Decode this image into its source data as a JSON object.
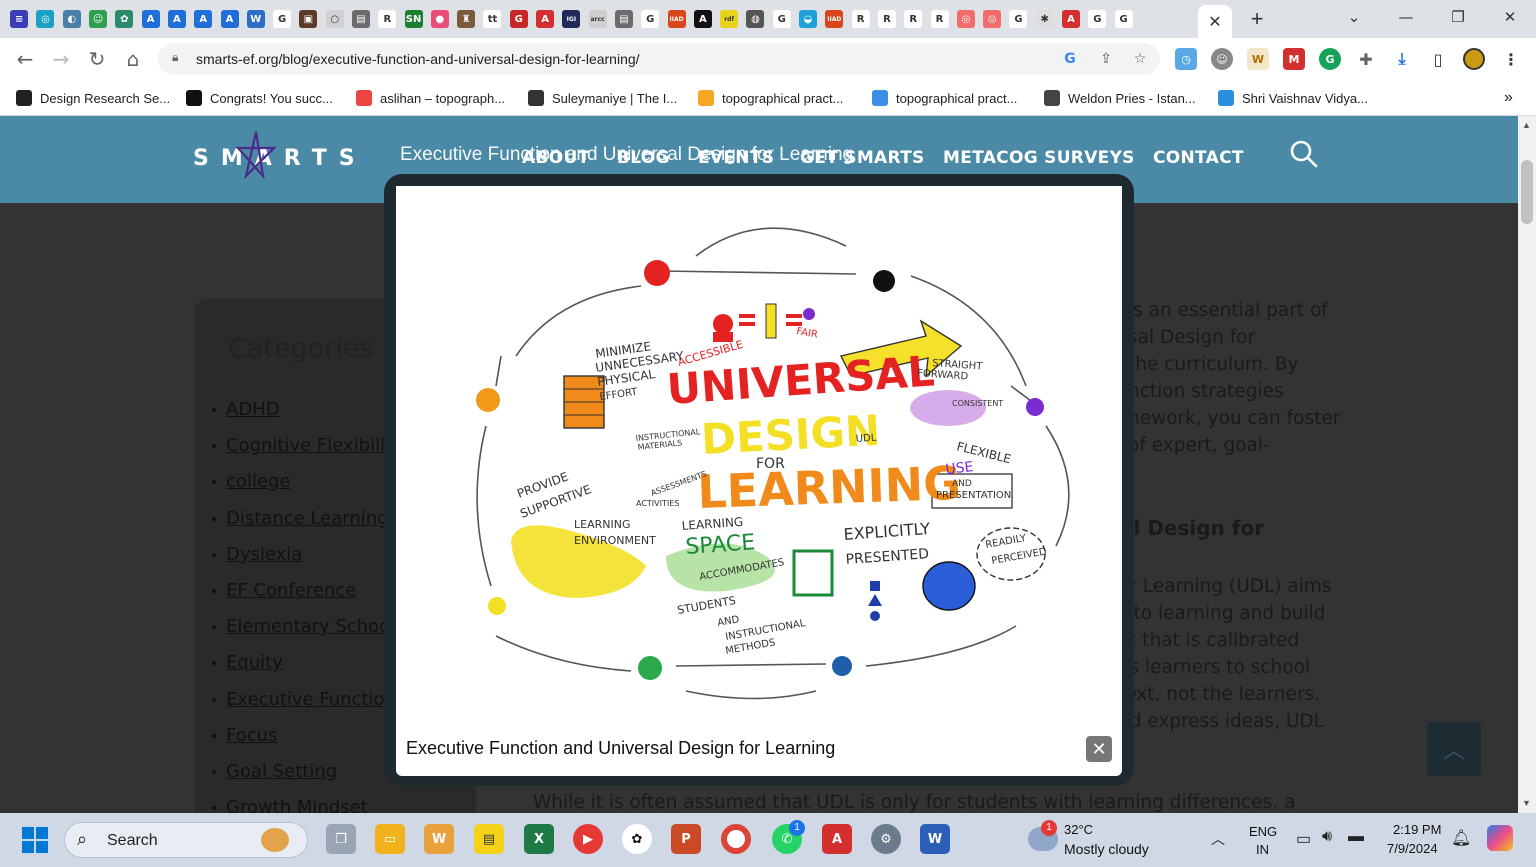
{
  "browser": {
    "tab_favicons": [
      {
        "icon": "list-icon",
        "color": "#3b3fb6",
        "glyph": "≡"
      },
      {
        "icon": "photo-icon",
        "color": "#19a0c2",
        "glyph": "◎"
      },
      {
        "icon": "globe-icon",
        "color": "#4a7fa8",
        "glyph": "◐"
      },
      {
        "icon": "android-icon",
        "color": "#2f9e4f",
        "glyph": "☺"
      },
      {
        "icon": "openai-icon",
        "color": "#2a8a6a",
        "glyph": "✿"
      },
      {
        "icon": "letter-a-icon",
        "color": "#1e6fd9",
        "glyph": "A"
      },
      {
        "icon": "letter-a-icon",
        "color": "#1e6fd9",
        "glyph": "A"
      },
      {
        "icon": "letter-a-icon",
        "color": "#1e6fd9",
        "glyph": "A"
      },
      {
        "icon": "letter-a-icon",
        "color": "#1e6fd9",
        "glyph": "A"
      },
      {
        "icon": "wordpress-icon",
        "color": "#2b6fc4",
        "glyph": "W"
      },
      {
        "icon": "google-icon",
        "color": "#ffffff",
        "glyph": "G"
      },
      {
        "icon": "image-icon",
        "color": "#5b3a2a",
        "glyph": "▣"
      },
      {
        "icon": "ring-icon",
        "color": "#d0d0d0",
        "glyph": "○"
      },
      {
        "icon": "picture-icon",
        "color": "#6b6b6b",
        "glyph": "▤"
      },
      {
        "icon": "researchgate-icon",
        "color": "#ffffff",
        "glyph": "R"
      },
      {
        "icon": "sn-icon",
        "color": "#1a7f2e",
        "glyph": "SN"
      },
      {
        "icon": "chat-icon",
        "color": "#e94c77",
        "glyph": "●"
      },
      {
        "icon": "castle-icon",
        "color": "#7a5a3a",
        "glyph": "♜"
      },
      {
        "icon": "tt-icon",
        "color": "#ffffff",
        "glyph": "tt"
      },
      {
        "icon": "grammarly-icon",
        "color": "#c62828",
        "glyph": "G"
      },
      {
        "icon": "pdf-icon",
        "color": "#d32f2f",
        "glyph": "A"
      },
      {
        "icon": "igi-icon",
        "color": "#1f2a5a",
        "glyph": "IGI"
      },
      {
        "icon": "arcc-icon",
        "color": "#cfcfcf",
        "glyph": "arcc"
      },
      {
        "icon": "picture-icon",
        "color": "#6b6b6b",
        "glyph": "▤"
      },
      {
        "icon": "google-icon",
        "color": "#ffffff",
        "glyph": "G"
      },
      {
        "icon": "iiad-icon",
        "color": "#d9461b",
        "glyph": "IIAD"
      },
      {
        "icon": "letter-a-box-icon",
        "color": "#111111",
        "glyph": "A"
      },
      {
        "icon": "rdf-icon",
        "color": "#e8d21a",
        "glyph": "rdf"
      },
      {
        "icon": "globe-icon",
        "color": "#555555",
        "glyph": "◍"
      },
      {
        "icon": "google-icon",
        "color": "#ffffff",
        "glyph": "G"
      },
      {
        "icon": "circle-icon",
        "color": "#1ca0d6",
        "glyph": "◒"
      },
      {
        "icon": "iiad-icon",
        "color": "#d9461b",
        "glyph": "IIAD"
      },
      {
        "icon": "researchgate-icon",
        "color": "#ffffff",
        "glyph": "R"
      },
      {
        "icon": "researchgate-icon",
        "color": "#ffffff",
        "glyph": "R"
      },
      {
        "icon": "researchgate-icon",
        "color": "#ffffff",
        "glyph": "R"
      },
      {
        "icon": "researchgate-icon",
        "color": "#ffffff",
        "glyph": "R"
      },
      {
        "icon": "target-icon",
        "color": "#f36b6b",
        "glyph": "◎"
      },
      {
        "icon": "target-icon",
        "color": "#f36b6b",
        "glyph": "◎"
      },
      {
        "icon": "google-icon",
        "color": "#ffffff",
        "glyph": "G"
      },
      {
        "icon": "settings-icon",
        "color": "#dddddd",
        "glyph": "✱"
      },
      {
        "icon": "pdf-icon",
        "color": "#d32f2f",
        "glyph": "A"
      },
      {
        "icon": "google-icon",
        "color": "#ffffff",
        "glyph": "G"
      },
      {
        "icon": "google-icon",
        "color": "#ffffff",
        "glyph": "G"
      }
    ],
    "active_tab_close": "✕",
    "new_tab": "+",
    "url": "smarts-ef.org/blog/executive-function-and-universal-design-for-learning/",
    "bookmarks": [
      {
        "label": "Design Research Se...",
        "icon": "design-research-icon",
        "color": "#222"
      },
      {
        "label": "Congrats! You succ...",
        "icon": "media-icon",
        "color": "#111"
      },
      {
        "label": "aslihan – topograph...",
        "icon": "medium-icon",
        "color": "#e44"
      },
      {
        "label": "Suleymaniye | The I...",
        "icon": "mosque-icon",
        "color": "#333"
      },
      {
        "label": "topographical pract...",
        "icon": "jd-icon",
        "color": "#f5a623"
      },
      {
        "label": "topographical pract...",
        "icon": "folder-icon",
        "color": "#3a8ee6"
      },
      {
        "label": "Weldon Pries - Istan...",
        "icon": "globe-icon",
        "color": "#444"
      },
      {
        "label": "Shri Vaishnav Vidya...",
        "icon": "cloud-icon",
        "color": "#2b8fe0"
      }
    ],
    "bookmarks_more": "»"
  },
  "site": {
    "logo": "SMARTS",
    "overlay_title": "Executive Function and Universal Design for Learning",
    "nav": [
      "ABOUT",
      "BLOG",
      "EVENTS",
      "GET SMARTS",
      "METACOG SURVEYS",
      "CONTACT"
    ],
    "categories_title": "Categories",
    "categories": [
      "ADHD",
      "Cognitive Flexibility",
      "college",
      "Distance Learning",
      "Dyslexia",
      "EF Conference",
      "Elementary School",
      "Equity",
      "Executive Function",
      "Focus",
      "Goal Setting",
      "Growth Mindset"
    ],
    "article_lines": [
      "is an essential part of",
      "sal Design for",
      "the curriculum. By",
      "nction strategies",
      "nework, you can foster",
      "of expert, goal-"
    ],
    "article_heading": "al Design for",
    "article_lines2": [
      "or Learning (UDL) aims",
      "s to learning and build",
      "rk that is calibrated",
      "es learners to school",
      "text, not the learners.",
      "nd express ideas, UDL"
    ],
    "article_bottom": "While it is often assumed that UDL is only for students with learning differences, a"
  },
  "lightbox": {
    "caption": "Executive Function and Universal Design for Learning",
    "close": "✕",
    "sketch": {
      "title_words": [
        "UNIVERSAL",
        "DESIGN",
        "FOR",
        "LEARNING"
      ],
      "labels": [
        "ACCESSIBLE",
        "FAIR",
        "MINIMIZE",
        "UNNECESSARY",
        "PHYSICAL",
        "EFFORT",
        "STRAIGHT",
        "FORWARD",
        "CONSISTENT",
        "INSTRUCTIONAL",
        "MATERIALS",
        "ASSESSMENTS",
        "ACTIVITIES",
        "UDL",
        "FLEXIBLE",
        "USE",
        "AND",
        "PRESENTATION",
        "PROVIDE",
        "SUPPORTIVE",
        "LEARNING",
        "ENVIRONMENT",
        "LEARNING",
        "SPACE",
        "ACCOMMODATES",
        "STUDENTS",
        "AND",
        "INSTRUCTIONAL",
        "METHODS",
        "EXPLICITLY",
        "PRESENTED",
        "READILY",
        "PERCEIVED"
      ]
    }
  },
  "taskbar": {
    "search": "Search",
    "weather_temp": "32°C",
    "weather_desc": "Mostly cloudy",
    "lang_top": "ENG",
    "lang_bottom": "IN",
    "time": "2:19 PM",
    "date": "7/9/2024",
    "notification_badge": "1",
    "whatsapp_badge": "1"
  }
}
